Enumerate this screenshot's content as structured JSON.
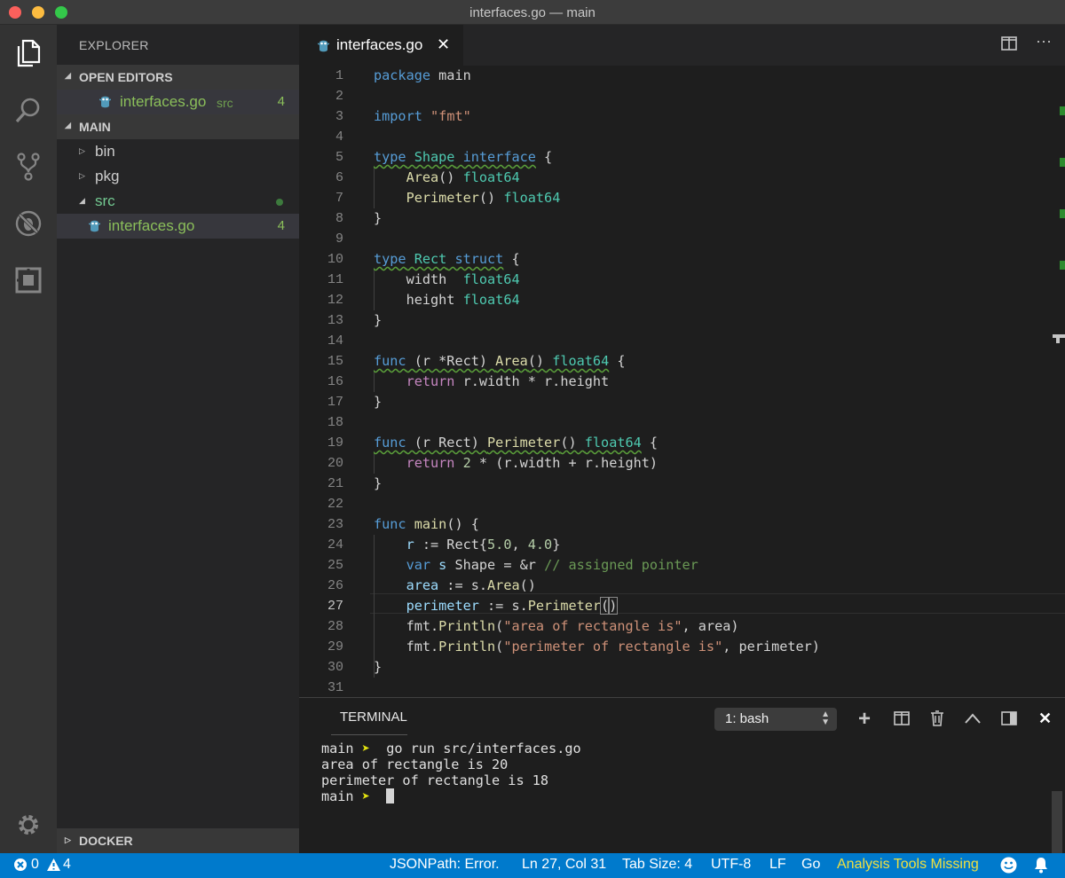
{
  "window": {
    "title": "interfaces.go — main"
  },
  "sidebar": {
    "title": "EXPLORER",
    "open_editors": {
      "label": "OPEN EDITORS",
      "items": [
        {
          "name": "interfaces.go",
          "folder": "src",
          "badge": "4"
        }
      ]
    },
    "main": {
      "label": "MAIN",
      "items": [
        {
          "name": "bin"
        },
        {
          "name": "pkg"
        },
        {
          "name": "src"
        },
        {
          "name": "interfaces.go",
          "badge": "4"
        }
      ]
    },
    "docker": {
      "label": "DOCKER"
    }
  },
  "editor": {
    "tab": {
      "label": "interfaces.go"
    },
    "lines": [
      "1",
      "2",
      "3",
      "4",
      "5",
      "6",
      "7",
      "8",
      "9",
      "10",
      "11",
      "12",
      "13",
      "14",
      "15",
      "16",
      "17",
      "18",
      "19",
      "20",
      "21",
      "22",
      "23",
      "24",
      "25",
      "26",
      "27",
      "28",
      "29",
      "30",
      "31"
    ],
    "code": {
      "l1": {
        "a": "package",
        "b": " main"
      },
      "l3": {
        "a": "import",
        "b": "\"fmt\""
      },
      "l5": {
        "a": "type",
        "b": "Shape",
        "c": "interface",
        "d": " {"
      },
      "l6": {
        "a": "Area",
        "b": "()",
        "c": "float64"
      },
      "l7": {
        "a": "Perimeter",
        "b": "()",
        "c": "float64"
      },
      "l8": "}",
      "l10": {
        "a": "type",
        "b": "Rect",
        "c": "struct",
        "d": " {"
      },
      "l11": {
        "a": "width",
        "b": "float64"
      },
      "l12": {
        "a": "height",
        "b": "float64"
      },
      "l13": "}",
      "l15": {
        "a": "func",
        "b": " (r *Rect) ",
        "c": "Area",
        "d": "()",
        "e": "float64",
        "f": " {"
      },
      "l16": {
        "a": "return",
        "b": " r.width * r.height"
      },
      "l17": "}",
      "l19": {
        "a": "func",
        "b": " (r Rect) ",
        "c": "Perimeter",
        "d": "()",
        "e": "float64",
        "f": " {"
      },
      "l20": {
        "a": "return",
        "b": "2",
        "c": " * (r.width + r.height)"
      },
      "l21": "}",
      "l23": {
        "a": "func",
        "b": "main",
        "c": "() {"
      },
      "l24": {
        "a": "r",
        "b": " := Rect{",
        "c": "5.0",
        "d": ", ",
        "e": "4.0",
        "f": "}"
      },
      "l25": {
        "a": "var",
        "b": "s",
        "c": " Shape = &r ",
        "d": "// assigned pointer"
      },
      "l26": {
        "a": "area",
        "b": " := s.",
        "c": "Area",
        "d": "()"
      },
      "l27": {
        "a": "perimeter",
        "b": " := s.",
        "c": "Perimeter",
        "d": "(",
        "e": ")"
      },
      "l28": {
        "a": "fmt.",
        "b": "Println",
        "c": "(",
        "d": "\"area of rectangle is\"",
        "e": ", area)"
      },
      "l29": {
        "a": "fmt.",
        "b": "Println",
        "c": "(",
        "d": "\"perimeter of rectangle is\"",
        "e": ", perimeter)"
      },
      "l30": "}"
    }
  },
  "panel": {
    "title": "TERMINAL",
    "shell_select": "1: bash",
    "lines": [
      {
        "prompt": "main",
        "arrow": "➤",
        "cmd": "go run src/interfaces.go"
      },
      {
        "text": "area of rectangle is 20"
      },
      {
        "text": "perimeter of rectangle is 18"
      },
      {
        "prompt": "main",
        "arrow": "➤"
      }
    ]
  },
  "statusbar": {
    "errors": "0",
    "warnings": "4",
    "jsonpath": "JSONPath: Error.",
    "position": "Ln 27, Col 31",
    "tab_size": "Tab Size: 4",
    "encoding": "UTF-8",
    "eol": "LF",
    "language": "Go",
    "analysis": "Analysis Tools Missing"
  },
  "colors": {
    "accent": "#007acc",
    "keyword": "#569cd6",
    "type": "#4ec9b0",
    "function": "#dcdcaa",
    "string": "#ce9178",
    "number": "#b5cea8",
    "comment": "#6a9955",
    "git_added": "#73c991"
  },
  "icons": [
    "files-icon",
    "search-icon",
    "source-control-icon",
    "debug-icon",
    "extensions-icon",
    "gear-icon",
    "go-file-icon",
    "split-editor-icon",
    "more-icon",
    "add-terminal-icon",
    "split-terminal-icon",
    "trash-icon",
    "maximize-panel-icon",
    "toggle-panel-icon",
    "close-panel-icon",
    "error-icon",
    "warning-icon",
    "feedback-smiley-icon",
    "bell-icon"
  ]
}
